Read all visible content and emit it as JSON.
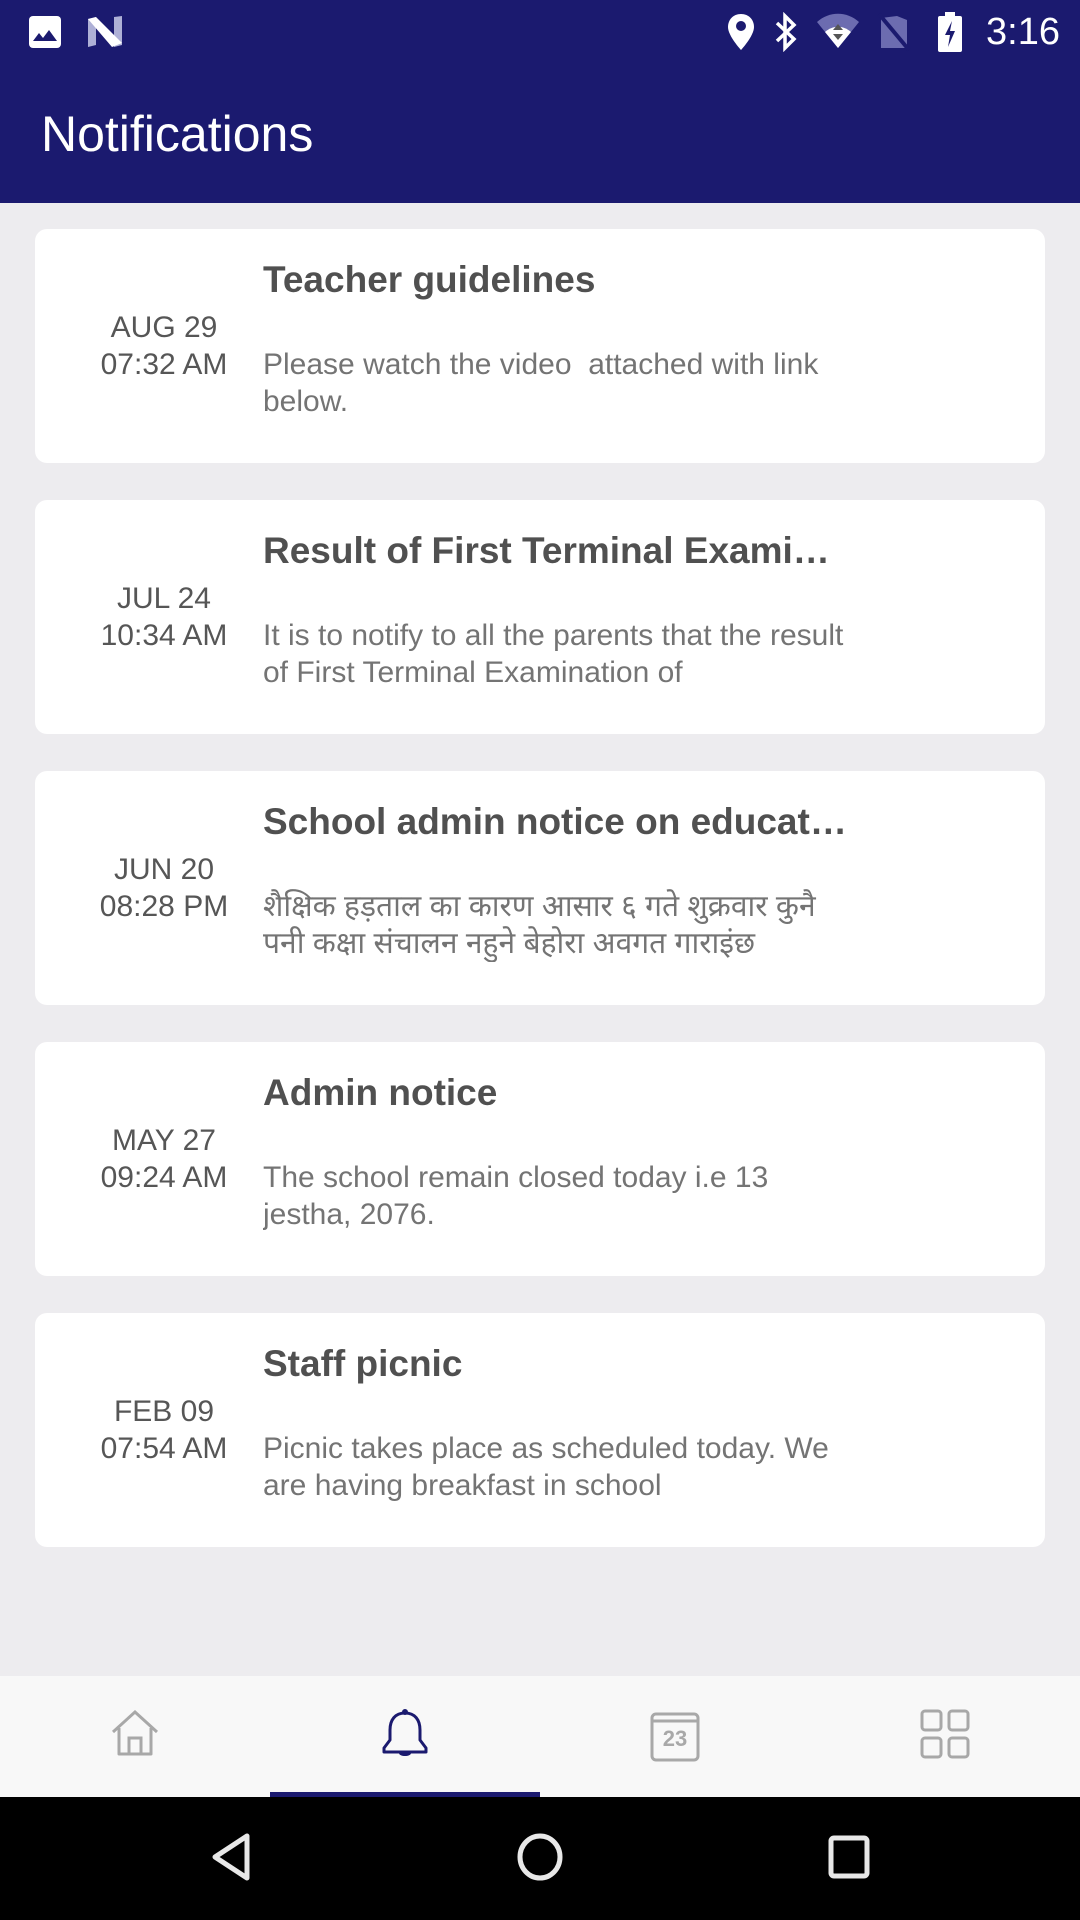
{
  "status_bar": {
    "time": "3:16",
    "left_icons": [
      "image-icon",
      "n-logo-icon"
    ],
    "right_icons": [
      "location-icon",
      "bluetooth-icon",
      "wifi-icon",
      "no-sim-icon",
      "battery-charging-icon"
    ]
  },
  "app_bar": {
    "title": "Notifications"
  },
  "notifications": [
    {
      "date": "AUG 29",
      "time": "07:32 AM",
      "title": "Teacher guidelines",
      "body": "Please watch the video  attached with link below."
    },
    {
      "date": "JUL 24",
      "time": "10:34 AM",
      "title": "Result of First Terminal Exami…",
      "body": "It is to notify to all the parents that the result of First Terminal Examination of"
    },
    {
      "date": "JUN 20",
      "time": "08:28 PM",
      "title": "School admin notice on educat…",
      "body": "शैक्षिक हड़ताल का कारण आसार ६ गते शुक्रवार कुनै पनी कक्षा संचालन नहुने बेहोरा अवगत गाराइंछ"
    },
    {
      "date": "MAY 27",
      "time": "09:24 AM",
      "title": "Admin notice",
      "body": "The school remain closed today i.e 13 jestha, 2076."
    },
    {
      "date": "FEB 09",
      "time": "07:54 AM",
      "title": "Staff picnic",
      "body": "Picnic takes place as scheduled today. We are having breakfast in school"
    }
  ],
  "bottom_nav": {
    "active_index": 1,
    "items": [
      {
        "icon": "home-icon"
      },
      {
        "icon": "bell-icon"
      },
      {
        "icon": "calendar-icon",
        "calendar_day": "23"
      },
      {
        "icon": "grid-icon"
      }
    ]
  },
  "system_nav": {
    "buttons": [
      "back",
      "home",
      "recents"
    ]
  },
  "colors": {
    "primary": "#1b1a6f",
    "background": "#edecef",
    "card": "#ffffff",
    "title_text": "#505050",
    "body_text": "#747474",
    "inactive_icon": "#a8a8a8"
  }
}
